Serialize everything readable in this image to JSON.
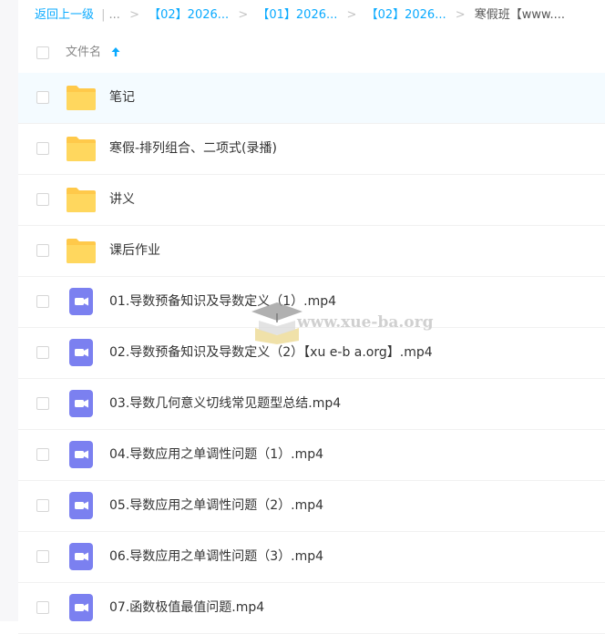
{
  "breadcrumb": {
    "back_label": "返回上一级",
    "divider": "|",
    "ellipsis": "...",
    "separator": ">",
    "items": [
      "【02】2026...",
      "【01】2026...",
      "【02】2026..."
    ],
    "current": "寒假班【www...."
  },
  "list_header": {
    "column_title": "文件名",
    "sort_icon": "arrow-up-icon"
  },
  "rows": [
    {
      "type": "folder",
      "icon": "folder-icon",
      "name": "笔记",
      "selected": true
    },
    {
      "type": "folder",
      "icon": "folder-icon",
      "name": "寒假-排列组合、二项式(录播)"
    },
    {
      "type": "folder",
      "icon": "folder-icon",
      "name": "讲义"
    },
    {
      "type": "folder",
      "icon": "folder-icon",
      "name": "课后作业"
    },
    {
      "type": "video",
      "icon": "video-file-icon",
      "name": "01.导数预备知识及导数定义（1）.mp4"
    },
    {
      "type": "video",
      "icon": "video-file-icon",
      "name": "02.导数预备知识及导数定义（2）【xu e-b a.org】.mp4"
    },
    {
      "type": "video",
      "icon": "video-file-icon",
      "name": "03.导数几何意义切线常见题型总结.mp4"
    },
    {
      "type": "video",
      "icon": "video-file-icon",
      "name": "04.导数应用之单调性问题（1）.mp4"
    },
    {
      "type": "video",
      "icon": "video-file-icon",
      "name": "05.导数应用之单调性问题（2）.mp4"
    },
    {
      "type": "video",
      "icon": "video-file-icon",
      "name": "06.导数应用之单调性问题（3）.mp4"
    },
    {
      "type": "video",
      "icon": "video-file-icon",
      "name": "07.函数极值最值问题.mp4"
    }
  ],
  "watermark": {
    "text": "www.xue-ba.org",
    "icon": "graduation-cap-icon"
  },
  "colors": {
    "accent": "#09aaff",
    "folder": "#ffd04c",
    "video": "#7a7ff0",
    "selected_row": "#f4fbff"
  }
}
